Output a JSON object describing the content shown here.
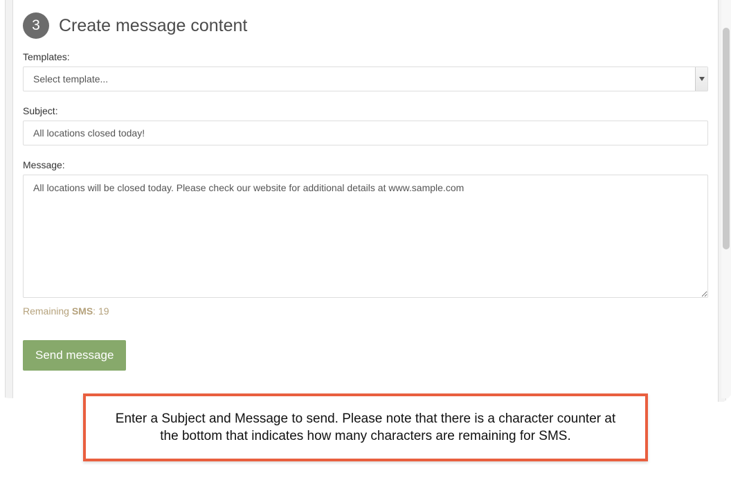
{
  "step": {
    "number": "3",
    "title": "Create message content"
  },
  "templates": {
    "label": "Templates:",
    "placeholder": "Select template..."
  },
  "subject": {
    "label": "Subject:",
    "value": "All locations closed today!"
  },
  "message": {
    "label": "Message:",
    "value": "All locations will be closed today. Please check our website for additional details at www.sample.com"
  },
  "counter": {
    "prefix": "Remaining ",
    "boldPart": "SMS",
    "suffix": ": 19"
  },
  "sendButton": {
    "label": "Send message"
  },
  "callout": {
    "text": "Enter a Subject and Message to send. Please note that there is a character counter at the bottom that indicates how many characters are remaining for SMS."
  }
}
